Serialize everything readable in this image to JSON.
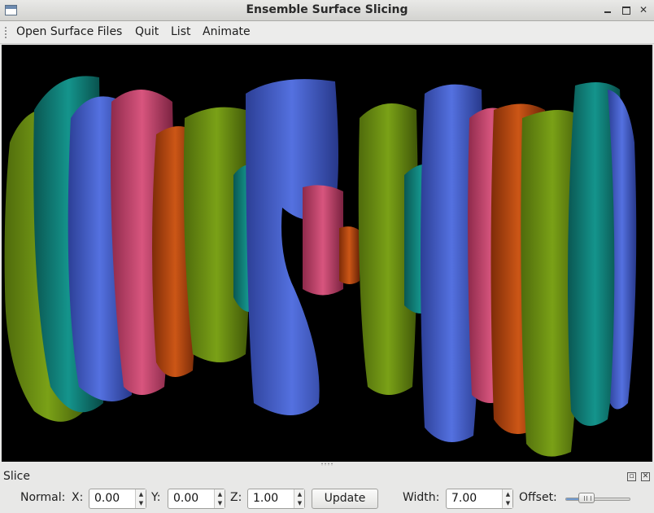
{
  "window": {
    "title": "Ensemble Surface Slicing",
    "minimize_glyph": "",
    "maximize_glyph": "",
    "close_glyph": "✕"
  },
  "menu": {
    "items": [
      "Open Surface Files",
      "Quit",
      "List",
      "Animate"
    ]
  },
  "viewport": {
    "background": "#000000",
    "slice_colors": {
      "olive": "#6b8f12",
      "teal": "#0f7f78",
      "blue": "#3f5ccf",
      "pink": "#c8466e",
      "orange": "#bd4a12"
    }
  },
  "dock": {
    "title": "Slice",
    "normal_label": "Normal:",
    "x_label": "X:",
    "x_value": "0.00",
    "y_label": "Y:",
    "y_value": "0.00",
    "z_label": "Z:",
    "z_value": "1.00",
    "update_label": "Update",
    "width_label": "Width:",
    "width_value": "7.00",
    "offset_label": "Offset:",
    "offset_level": 0.25
  },
  "icons": [
    "app-window-icon",
    "minimize-icon",
    "maximize-icon",
    "close-icon",
    "dock-float-icon",
    "dock-close-icon",
    "toolbar-grip-icon",
    "spin-up-icon",
    "spin-down-icon"
  ]
}
